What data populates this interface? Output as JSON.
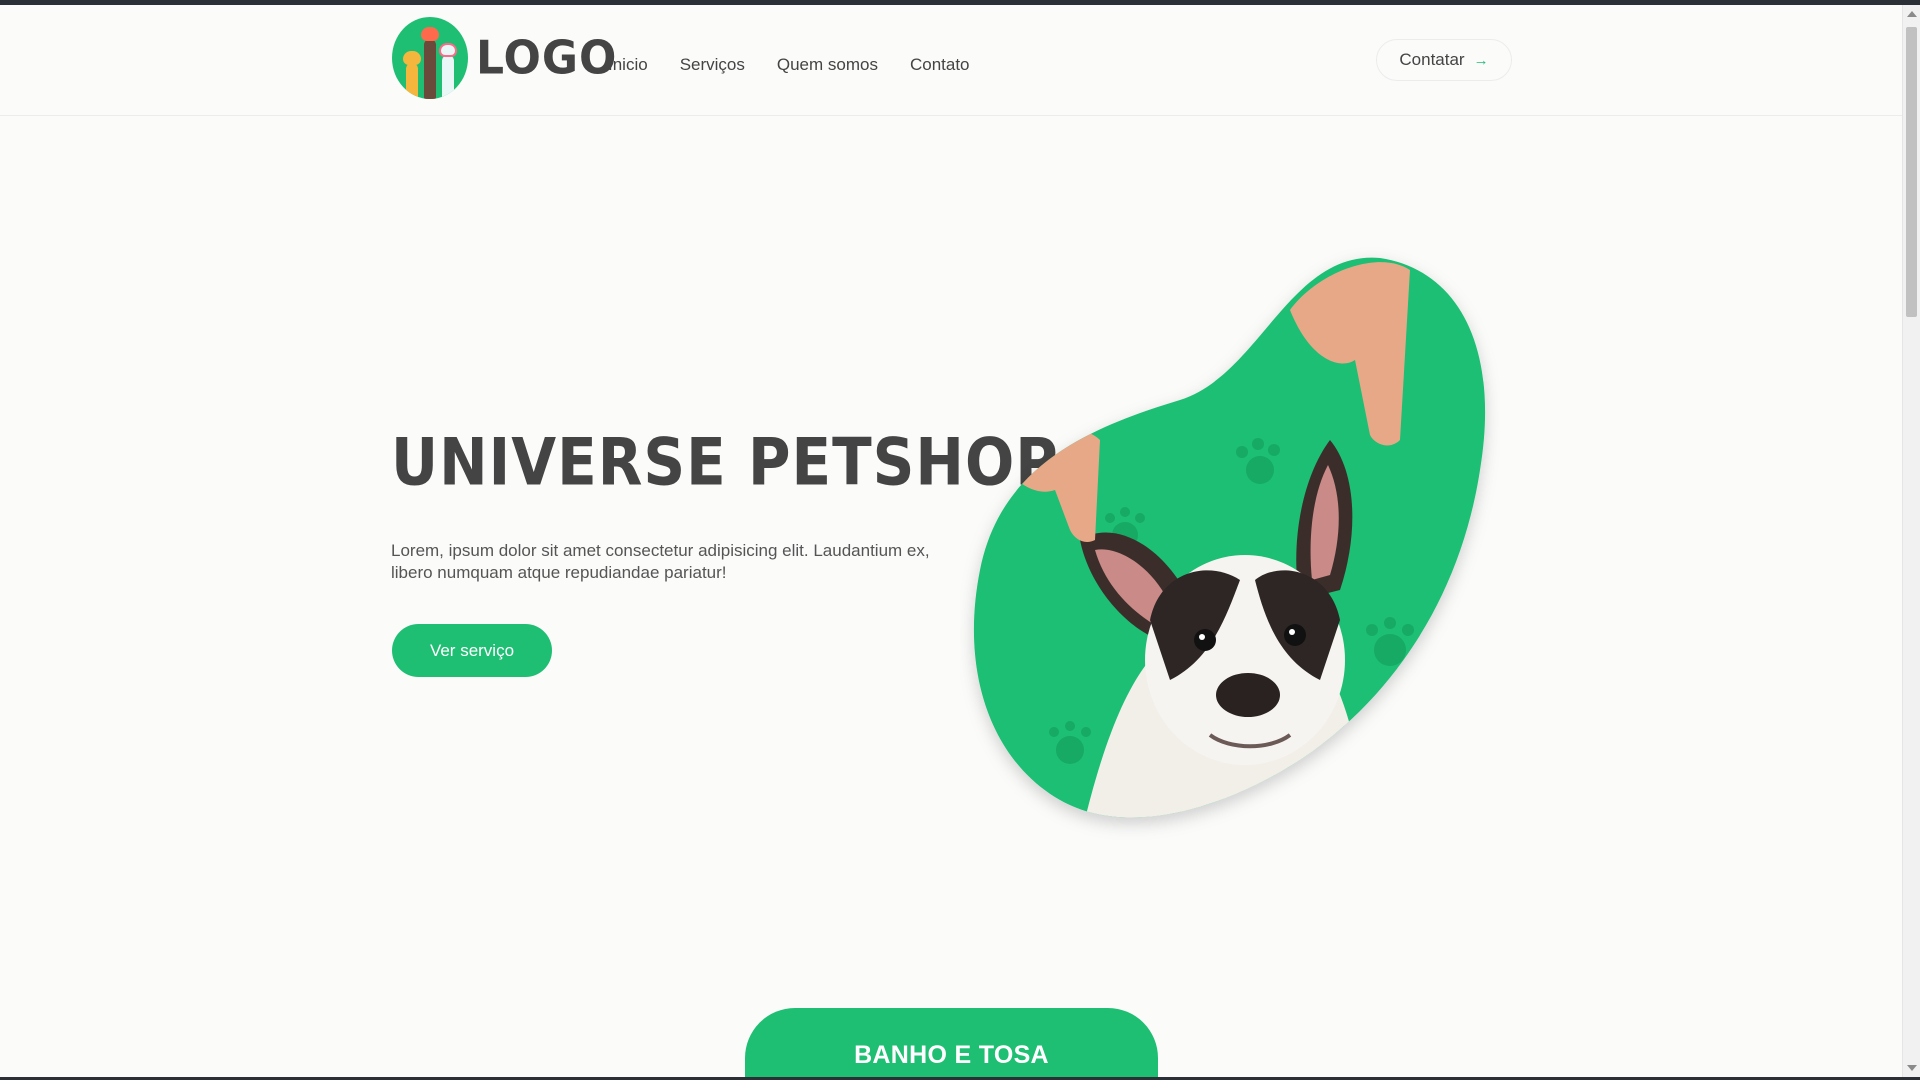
{
  "header": {
    "logo_text": "LOGO",
    "nav": [
      "Inicio",
      "Serviços",
      "Quem somos",
      "Contato"
    ],
    "contact_label": "Contatar",
    "contact_icon": "arrow-right-icon"
  },
  "hero": {
    "title": "UNIVERSE PETSHOP",
    "text": "Lorem, ipsum dolor sit amet consectetur adipisicing elit. Laudantium ex, libero numquam atque repudiandae pariatur!",
    "cta_label": "Ver serviço",
    "image": "dog-with-ears-held-up"
  },
  "services": {
    "first_card_title": "BANHO E TOSA"
  },
  "colors": {
    "accent": "#1fbf73",
    "text": "#444444",
    "background": "#fbfbfa"
  }
}
